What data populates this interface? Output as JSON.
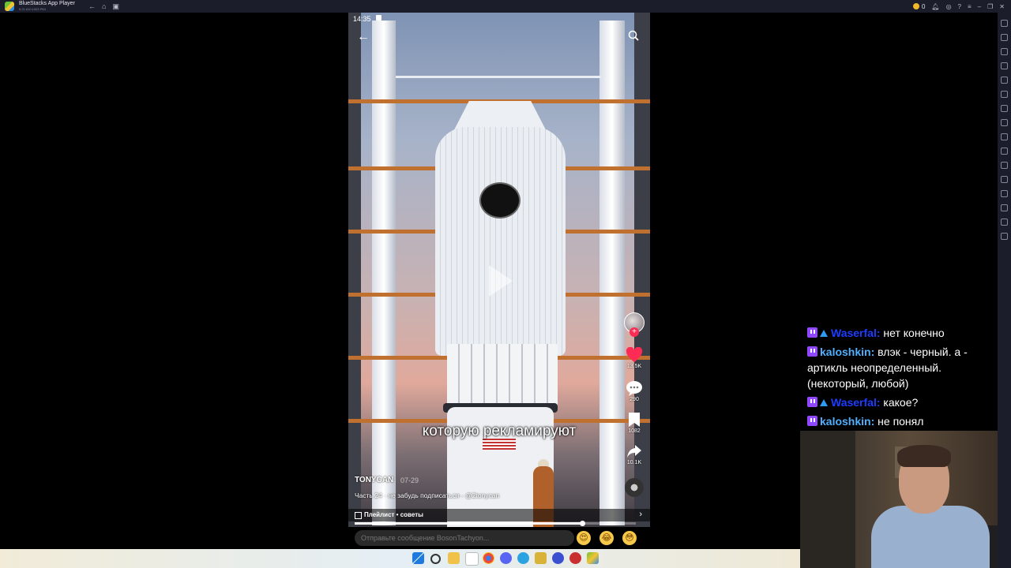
{
  "titlebar": {
    "app_name": "BlueStacks App Player",
    "app_subtitle": "5.21.610.1003  P64",
    "coins": "0"
  },
  "phone": {
    "status_time": "14:35",
    "subtitle": "которую рекламируют",
    "actions": {
      "likes": "13.5K",
      "comments": "290",
      "bookmarks": "1082",
      "shares": "10.1K"
    },
    "author": "TONYCAN",
    "time_ago": "07-29",
    "caption": "Часть 24 · не забудь подписаться - @2tonycan",
    "playlist_label": "Плейлист • советы",
    "progress_fraction": 0.81,
    "message_placeholder": "Отправьте сообщение BosonTachyon..."
  },
  "colors": {
    "like_red": "#fe2c55",
    "twitch_purple": "#9146ff",
    "username_waserfal": "#1e3cff",
    "username_kaloshkin": "#4fb0ff"
  },
  "chat": {
    "messages": [
      {
        "user": "Waserfal",
        "text": "нет конечно"
      },
      {
        "user": "kaloshkin",
        "text": "влэк - черный. а - артикль неопределенный. (некоторый, любой)"
      },
      {
        "user": "Waserfal",
        "text": "какое?"
      },
      {
        "user": "kaloshkin",
        "text": "не понял"
      }
    ]
  },
  "emojis": [
    "heart-eyes-emoji",
    "laughing-emoji",
    "flushed-emoji"
  ]
}
